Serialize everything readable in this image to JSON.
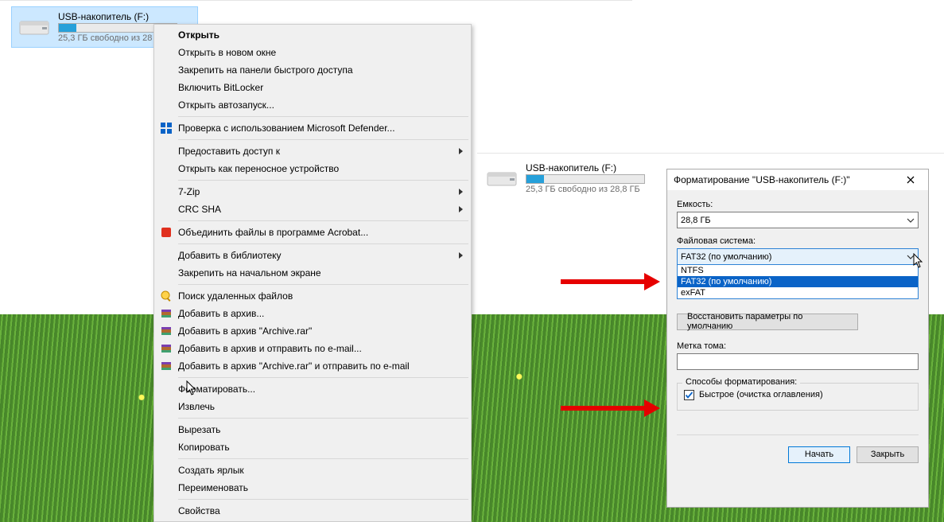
{
  "drive": {
    "name": "USB-накопитель (F:)",
    "free_text": "25,3 ГБ свободно из 28,8 ГБ",
    "free_text_clipped": "25,3 ГБ свободно из 28"
  },
  "context_menu": {
    "open": "Открыть",
    "open_new_window": "Открыть в новом окне",
    "pin_quick_access": "Закрепить на панели быстрого доступа",
    "bitlocker": "Включить BitLocker",
    "autoplay": "Открыть автозапуск...",
    "defender": "Проверка с использованием Microsoft Defender...",
    "give_access": "Предоставить доступ к",
    "portable_device": "Открыть как переносное устройство",
    "seven_zip": "7-Zip",
    "crc_sha": "CRC SHA",
    "acrobat": "Объединить файлы в программе Acrobat...",
    "add_library": "Добавить в библиотеку",
    "pin_start": "Закрепить на начальном экране",
    "search_deleted": "Поиск удаленных файлов",
    "add_archive": "Добавить в архив...",
    "add_archive_rar": "Добавить в архив \"Archive.rar\"",
    "add_archive_email": "Добавить в архив и отправить по e-mail...",
    "add_archive_rar_email": "Добавить в архив \"Archive.rar\" и отправить по e-mail",
    "format": "Форматировать...",
    "eject": "Извлечь",
    "cut": "Вырезать",
    "copy": "Копировать",
    "create_shortcut": "Создать ярлык",
    "rename": "Переименовать",
    "properties": "Свойства"
  },
  "format_dialog": {
    "title": "Форматирование \"USB-накопитель (F:)\"",
    "capacity_label": "Емкость:",
    "capacity_value": "28,8 ГБ",
    "fs_label": "Файловая система:",
    "fs_selected": "FAT32 (по умолчанию)",
    "fs_options": {
      "ntfs": "NTFS",
      "fat32": "FAT32 (по умолчанию)",
      "exfat": "exFAT"
    },
    "restore_defaults": "Восстановить параметры по умолчанию",
    "volume_label": "Метка тома:",
    "methods_label": "Способы форматирования:",
    "quick_format": "Быстрое (очистка оглавления)",
    "start": "Начать",
    "close": "Закрыть"
  }
}
